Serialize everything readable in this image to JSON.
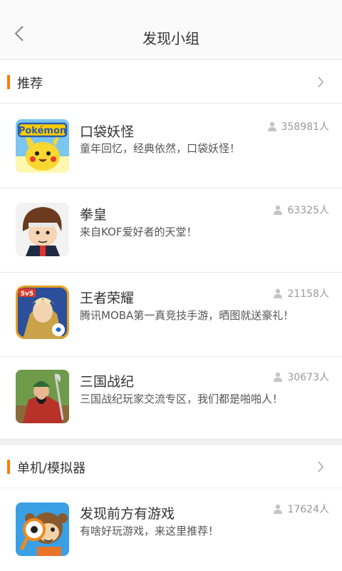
{
  "header": {
    "title": "发现小组"
  },
  "sections": [
    {
      "title": "推荐",
      "items": [
        {
          "title": "口袋妖怪",
          "desc": "童年回忆，经典依然，口袋妖怪！",
          "count": "358981人",
          "icon": "pokemon-thumbnail"
        },
        {
          "title": "拳皇",
          "desc": "来自KOF爱好者的天堂！",
          "count": "63325人",
          "icon": "kof-thumbnail"
        },
        {
          "title": "王者荣耀",
          "desc": "腾讯MOBA第一真竞技手游，晒图就送豪礼！",
          "count": "21158人",
          "icon": "honor-of-kings-thumbnail"
        },
        {
          "title": "三国战纪",
          "desc": "三国战纪玩家交流专区，我们都是啪啪人！",
          "count": "30673人",
          "icon": "three-kingdoms-thumbnail"
        }
      ]
    },
    {
      "title": "单机/模拟器",
      "items": [
        {
          "title": "发现前方有游戏",
          "desc": "有啥好玩游戏，来这里推荐！",
          "count": "17624人",
          "icon": "monkey-magnifier-thumbnail"
        }
      ]
    }
  ],
  "colors": {
    "accent": "#ff7a00",
    "divider": "#e6e6e6",
    "band": "#eef0f2"
  }
}
